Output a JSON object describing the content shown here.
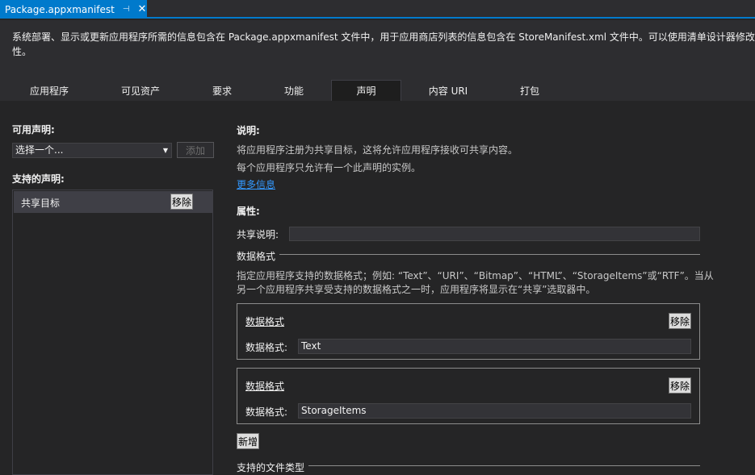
{
  "document_tab": {
    "title": "Package.appxmanifest",
    "pin_icon": "pin-icon",
    "close_icon": "close-icon"
  },
  "header": {
    "description_line1": "系统部署、显示或更新应用程序所需的信息包含在 Package.appxmanifest 文件中，用于应用商店列表的信息包含在 StoreManifest.xml 文件中。可以使用清单设计器修改这",
    "description_line2": "性。"
  },
  "tabs": [
    {
      "label": "应用程序",
      "active": false
    },
    {
      "label": "可见资产",
      "active": false
    },
    {
      "label": "要求",
      "active": false
    },
    {
      "label": "功能",
      "active": false
    },
    {
      "label": "声明",
      "active": true
    },
    {
      "label": "内容 URI",
      "active": false
    },
    {
      "label": "打包",
      "active": false
    }
  ],
  "left": {
    "available_label": "可用声明:",
    "select_value": "选择一个...",
    "add_label": "添加",
    "supported_label": "支持的声明:",
    "supported_items": [
      {
        "name": "共享目标",
        "remove_label": "移除"
      }
    ]
  },
  "right": {
    "desc_heading": "说明:",
    "desc_line1": "将应用程序注册为共享目标，这将允许应用程序接收可共享内容。",
    "desc_line2": "每个应用程序只允许有一个此声明的实例。",
    "more_info": "更多信息",
    "props_heading": "属性:",
    "share_desc_label": "共享说明:",
    "share_desc_value": "",
    "data_format_section": "数据格式",
    "data_format_help_line1": "指定应用程序支持的数据格式；例如: “Text”、“URI”、“Bitmap”、“HTML”、“StorageItems”或“RTF”。当从",
    "data_format_help_line2": "另一个应用程序共享受支持的数据格式之一时，应用程序将显示在“共享”选取器中。",
    "formats": [
      {
        "title": "数据格式",
        "label": "数据格式:",
        "value": "Text",
        "remove_label": "移除"
      },
      {
        "title": "数据格式",
        "label": "数据格式:",
        "value": "StorageItems",
        "remove_label": "移除"
      }
    ],
    "new_label": "新增",
    "file_types_section": "支持的文件类型"
  },
  "colors": {
    "accent": "#007acc",
    "background": "#252526",
    "link": "#3399ff"
  }
}
